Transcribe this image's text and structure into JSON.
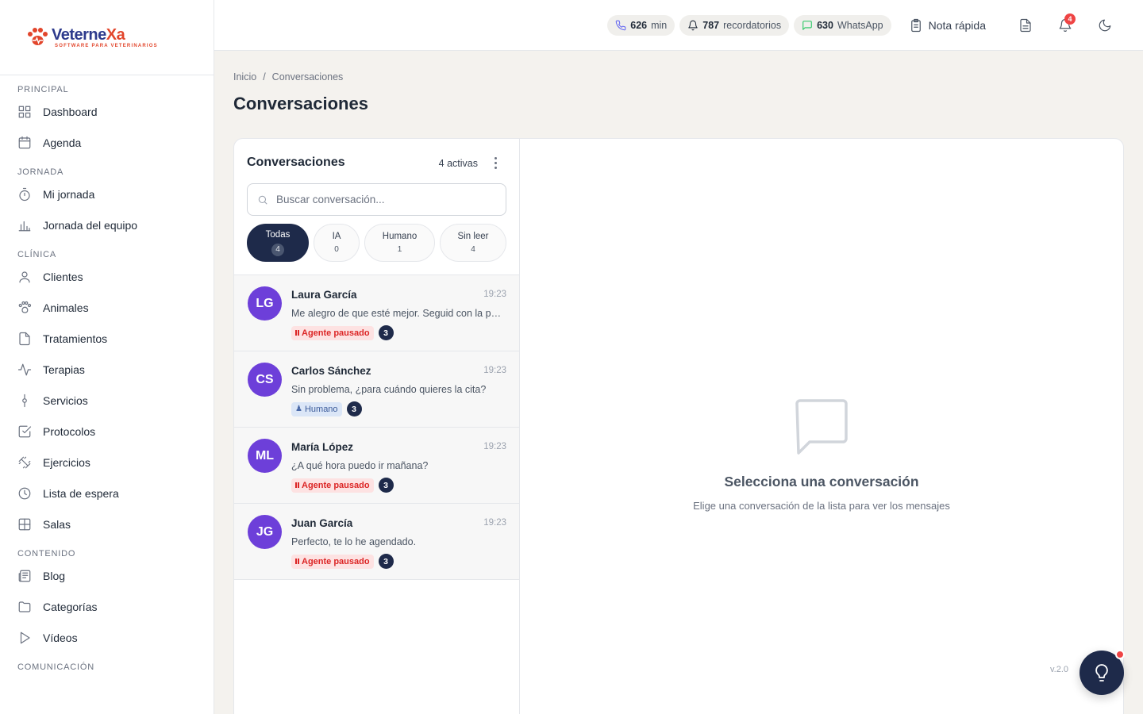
{
  "brand": {
    "name_part1": "Veterne",
    "name_part2": "Xa",
    "tagline": "SOFTWARE PARA VETERINARIOS"
  },
  "sidebar": {
    "sections": [
      {
        "label": "PRINCIPAL",
        "items": [
          {
            "label": "Dashboard",
            "icon": "grid-icon"
          },
          {
            "label": "Agenda",
            "icon": "calendar-icon"
          }
        ]
      },
      {
        "label": "JORNADA",
        "items": [
          {
            "label": "Mi jornada",
            "icon": "stopwatch-icon"
          },
          {
            "label": "Jornada del equipo",
            "icon": "bar-chart-icon"
          }
        ]
      },
      {
        "label": "CLÍNICA",
        "items": [
          {
            "label": "Clientes",
            "icon": "user-icon"
          },
          {
            "label": "Animales",
            "icon": "paw-icon"
          },
          {
            "label": "Tratamientos",
            "icon": "file-icon"
          },
          {
            "label": "Terapias",
            "icon": "activity-icon"
          },
          {
            "label": "Servicios",
            "icon": "pin-icon"
          },
          {
            "label": "Protocolos",
            "icon": "checkbox-icon"
          },
          {
            "label": "Ejercicios",
            "icon": "dumbbell-icon"
          },
          {
            "label": "Lista de espera",
            "icon": "clock-icon"
          },
          {
            "label": "Salas",
            "icon": "layout-icon"
          }
        ]
      },
      {
        "label": "CONTENIDO",
        "items": [
          {
            "label": "Blog",
            "icon": "newspaper-icon"
          },
          {
            "label": "Categorías",
            "icon": "folder-icon"
          },
          {
            "label": "Vídeos",
            "icon": "play-icon"
          }
        ]
      },
      {
        "label": "COMUNICACIÓN",
        "items": []
      }
    ]
  },
  "topbar": {
    "calls": {
      "value": "626",
      "unit": "min"
    },
    "reminders": {
      "value": "787",
      "unit": "recordatorios"
    },
    "whatsapp": {
      "value": "630",
      "unit": "WhatsApp"
    },
    "quick_note": "Nota rápida",
    "notifications_count": "4"
  },
  "breadcrumb": {
    "home": "Inicio",
    "separator": "/",
    "current": "Conversaciones"
  },
  "page_title": "Conversaciones",
  "conversations": {
    "title": "Conversaciones",
    "active_count": "4 activas",
    "search_placeholder": "Buscar conversación...",
    "filters": [
      {
        "label": "Todas",
        "count": "4",
        "active": true
      },
      {
        "label": "IA",
        "count": "0",
        "active": false
      },
      {
        "label": "Humano",
        "count": "1",
        "active": false
      },
      {
        "label": "Sin leer",
        "count": "4",
        "active": false
      }
    ],
    "items": [
      {
        "initials": "LG",
        "name": "Laura García",
        "time": "19:23",
        "message": "Me alegro de que esté mejor. Seguid con la pauta",
        "tag": "Agente pausado",
        "tag_type": "paused",
        "unread": "3"
      },
      {
        "initials": "CS",
        "name": "Carlos Sánchez",
        "time": "19:23",
        "message": "Sin problema, ¿para cuándo quieres la cita?",
        "tag": "Humano",
        "tag_type": "human",
        "unread": "3"
      },
      {
        "initials": "ML",
        "name": "María López",
        "time": "19:23",
        "message": "¿A qué hora puedo ir mañana?",
        "tag": "Agente pausado",
        "tag_type": "paused",
        "unread": "3"
      },
      {
        "initials": "JG",
        "name": "Juan García",
        "time": "19:23",
        "message": "Perfecto, te lo he agendado.",
        "tag": "Agente pausado",
        "tag_type": "paused",
        "unread": "3"
      }
    ]
  },
  "empty_state": {
    "title": "Selecciona una conversación",
    "subtitle": "Elige una conversación de la lista para ver los mensajes"
  },
  "version": "v.2.0",
  "colors": {
    "primary_dark": "#1e2a4a",
    "avatar": "#6d3fd9",
    "brand_blue": "#2d3a8c",
    "brand_red": "#e2452b",
    "danger": "#ef4444"
  }
}
